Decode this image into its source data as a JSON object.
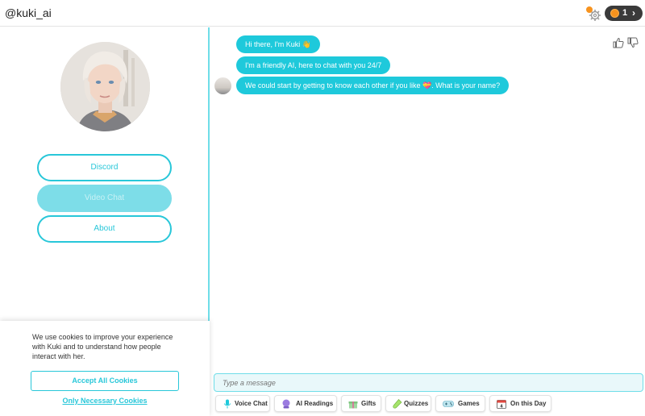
{
  "header": {
    "title": "@kuki_ai",
    "coin_count": "1",
    "chevron": "›",
    "colors": {
      "accent": "#28c7d9",
      "coin": "#f7931e",
      "pill": "#3a3a3a"
    }
  },
  "sidebar": {
    "avatar_icon": "kuki-avatar",
    "buttons": [
      {
        "label": "Discord",
        "state": "enabled"
      },
      {
        "label": "Video Chat",
        "state": "disabled"
      },
      {
        "label": "About",
        "state": "enabled"
      }
    ]
  },
  "cookie_banner": {
    "text": "We use cookies to improve your experience with Kuki and to understand how people interact with her.",
    "accept_label": "Accept All Cookies",
    "necessary_label": "Only Necessary Cookies"
  },
  "chat": {
    "messages": [
      {
        "text": "Hi there, I'm Kuki 👋"
      },
      {
        "text": "I'm a friendly AI, here to chat with you 24/7"
      },
      {
        "text": "We could start by getting to know each other if you like 💝. What is your name?"
      }
    ],
    "feedback_icons": [
      "thumbs-up-icon",
      "thumbs-down-icon"
    ]
  },
  "composer": {
    "placeholder": "Type a message"
  },
  "chips": [
    {
      "label": "Voice Chat",
      "icon": "microphone-icon"
    },
    {
      "label": "AI Readings",
      "icon": "crystal-ball-icon"
    },
    {
      "label": "Gifts",
      "icon": "gift-icon"
    },
    {
      "label": "Quizzes",
      "icon": "test-tube-icon"
    },
    {
      "label": "Games",
      "icon": "gamepad-icon"
    },
    {
      "label": "On this Day",
      "icon": "calendar-icon"
    }
  ]
}
